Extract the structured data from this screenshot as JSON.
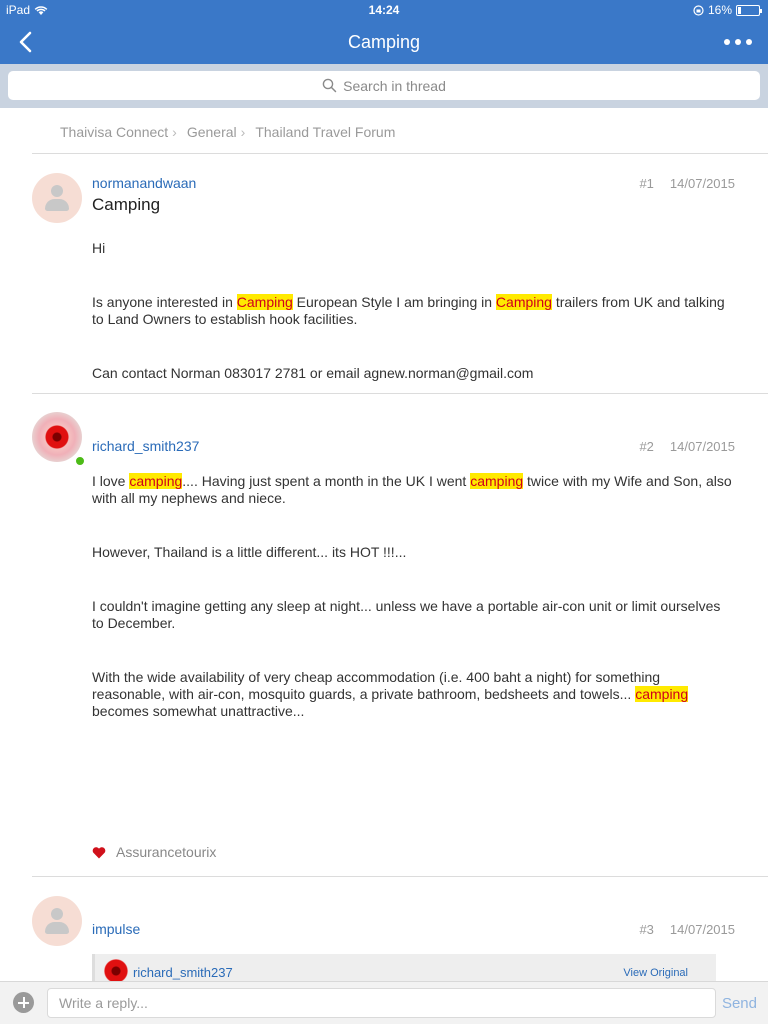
{
  "status": {
    "device": "iPad",
    "time": "14:24",
    "battery": "16%",
    "battery_level": 0.16
  },
  "nav": {
    "title": "Camping"
  },
  "search": {
    "placeholder": "Search in thread"
  },
  "breadcrumb": {
    "items": [
      "Thaivisa Connect",
      "General",
      "Thailand Travel Forum"
    ]
  },
  "posts": [
    {
      "username": "normanandwaan",
      "number": "#1",
      "date": "14/07/2015",
      "title": "Camping",
      "paragraphs": [
        [
          "Hi"
        ],
        [
          "Is anyone interested in ",
          {
            "hl": "Camping"
          },
          " European Style I am bringing in ",
          {
            "hl": "Camping"
          },
          " trailers from UK and talking to Land Owners to establish hook facilities."
        ],
        [
          "Can contact Norman 083017 2781 or email agnew.norman@gmail.com"
        ]
      ]
    },
    {
      "username": "richard_smith237",
      "number": "#2",
      "date": "14/07/2015",
      "paragraphs": [
        [
          "I love ",
          {
            "hl": "camping"
          },
          "....  Having just spent a month in the UK I went ",
          {
            "hl": "camping"
          },
          " twice with my Wife and Son, also with all my nephews and niece."
        ],
        [
          "However, Thailand is a little different... its HOT !!!..."
        ],
        [
          "I couldn't imagine getting any sleep at night... unless we have a portable air-con unit or limit ourselves to December."
        ],
        [
          "With the wide availability of very cheap accommodation (i.e. 400 baht a night) for something reasonable, with air-con, mosquito guards, a private bathroom, bedsheets and towels... ",
          {
            "hl": "camping"
          },
          " becomes somewhat unattractive..."
        ]
      ],
      "liked_by": "Assurancetourix"
    },
    {
      "username": "impulse",
      "number": "#3",
      "date": "14/07/2015",
      "quote": {
        "username": "richard_smith237",
        "view_label": "View Original"
      }
    }
  ],
  "reply": {
    "placeholder": "Write a reply...",
    "send_label": "Send"
  },
  "colors": {
    "accent": "#3a78c8",
    "link": "#2a6bb8",
    "highlight_bg": "#ffea00",
    "highlight_text": "#d0001b",
    "online": "#4cbb17"
  }
}
